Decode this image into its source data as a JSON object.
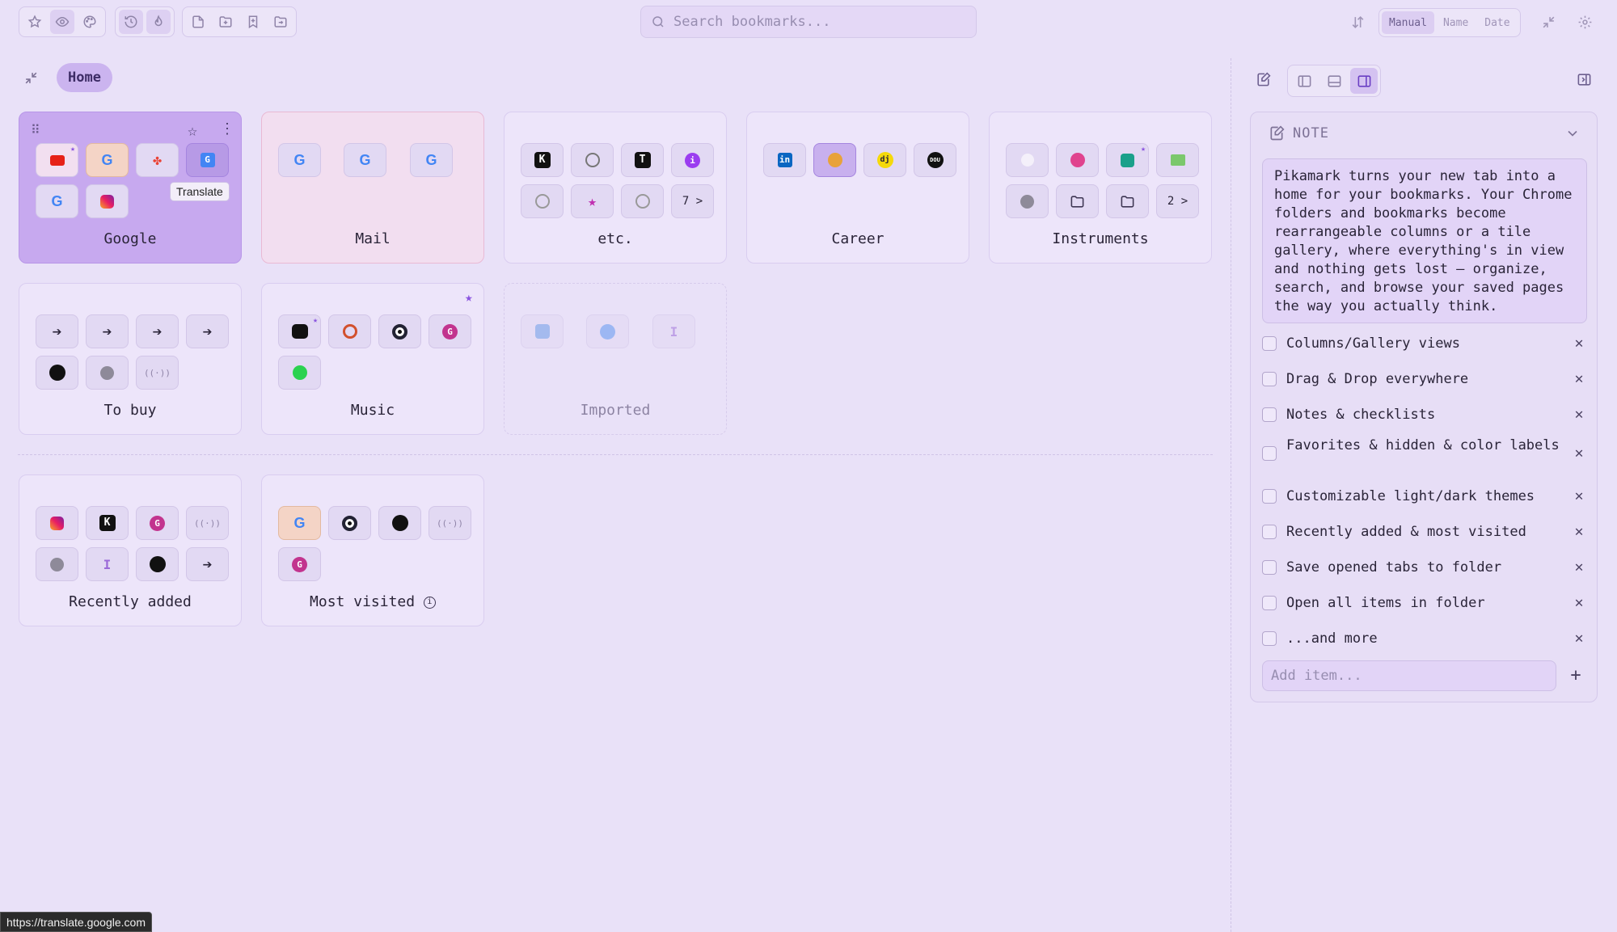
{
  "search": {
    "placeholder": "Search bookmarks..."
  },
  "sort": {
    "options": [
      "Manual",
      "Name",
      "Date"
    ],
    "active": "Manual"
  },
  "breadcrumb": {
    "home": "Home"
  },
  "folders": [
    {
      "name": "Google",
      "more": ""
    },
    {
      "name": "Mail",
      "more": ""
    },
    {
      "name": "etc.",
      "more": "7 >"
    },
    {
      "name": "Career",
      "more": ""
    },
    {
      "name": "Instruments",
      "more": "2 >"
    },
    {
      "name": "To buy",
      "more": ""
    },
    {
      "name": "Music",
      "more": ""
    },
    {
      "name": "Imported",
      "more": ""
    },
    {
      "name": "Recently added",
      "more": ""
    },
    {
      "name": "Most visited",
      "more": ""
    }
  ],
  "tooltip": {
    "text": "Translate"
  },
  "note": {
    "title": "NOTE",
    "text": "Pikamark turns your new tab into a home for your bookmarks. Your Chrome folders and bookmarks become rearrangeable columns or a tile gallery, where everything's in view and nothing gets lost — organize, search, and browse your saved pages the way you actually think.",
    "items": [
      "Columns/Gallery views",
      "Drag & Drop everywhere",
      "Notes & checklists",
      "Favorites & hidden & color labels",
      "Customizable light/dark themes",
      "Recently added & most visited",
      "Save opened tabs to folder",
      "Open all items in folder",
      "...and more"
    ],
    "add_placeholder": "Add item..."
  },
  "statusbar": {
    "url": "https://translate.google.com"
  },
  "colors": {
    "accent": "#8b55e0",
    "background": "#e9e1f8",
    "selected_folder": "#c7a9ef"
  }
}
